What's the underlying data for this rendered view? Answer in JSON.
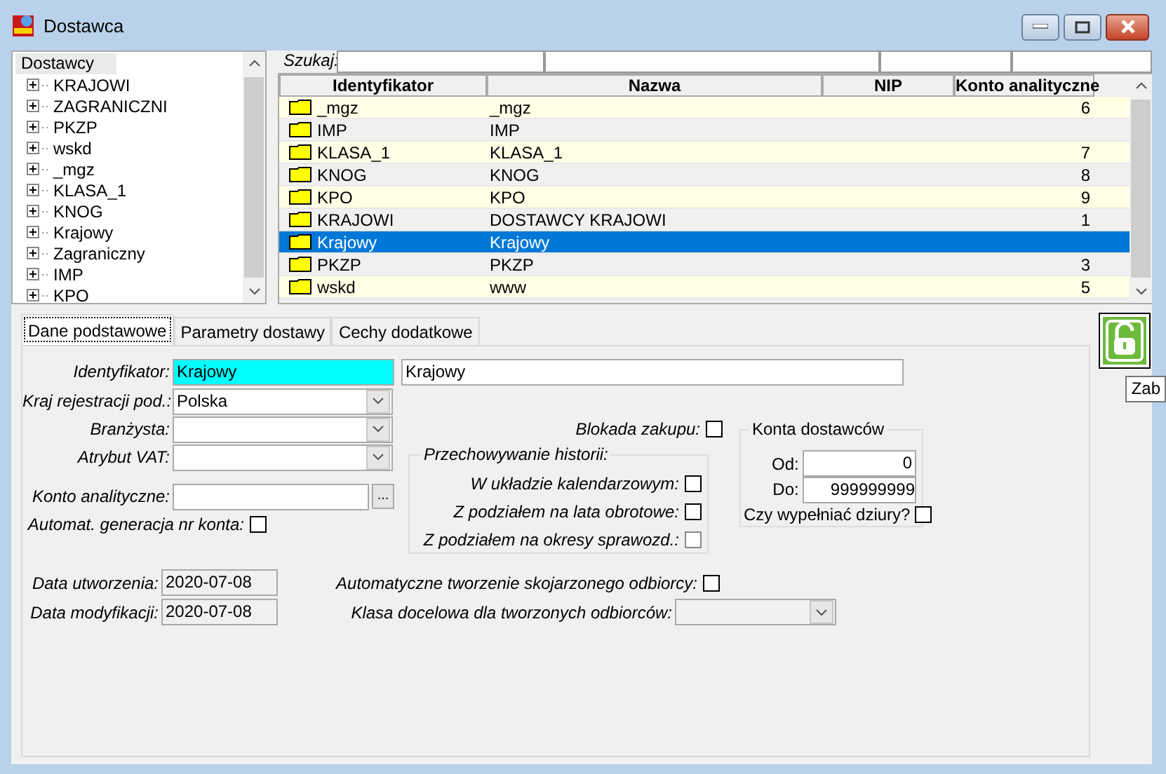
{
  "window": {
    "title": "Dostawca"
  },
  "tree": {
    "root": "Dostawcy",
    "items": [
      {
        "label": "KRAJOWI",
        "expanded": false
      },
      {
        "label": "ZAGRANICZNI",
        "expanded": false
      },
      {
        "label": "PKZP",
        "expanded": false
      },
      {
        "label": "wskd",
        "expanded": false
      },
      {
        "label": "_mgz",
        "expanded": false
      },
      {
        "label": "KLASA_1",
        "expanded": false
      },
      {
        "label": "KNOG",
        "expanded": false
      },
      {
        "label": "Krajowy",
        "expanded": false
      },
      {
        "label": "Zagraniczny",
        "expanded": false
      },
      {
        "label": "IMP",
        "expanded": false
      },
      {
        "label": "KPO",
        "expanded": false
      }
    ]
  },
  "search": {
    "label": "Szukaj:"
  },
  "table": {
    "columns": [
      "Identyfikator",
      "Nazwa",
      "NIP",
      "Konto analityczne"
    ],
    "rows": [
      {
        "identyfikator": "_mgz",
        "nazwa": "_mgz",
        "konto": "6",
        "selected": false
      },
      {
        "identyfikator": "IMP",
        "nazwa": "IMP",
        "selected": false
      },
      {
        "identyfikator": "KLASA_1",
        "nazwa": "KLASA_1",
        "konto": "7",
        "selected": false
      },
      {
        "identyfikator": "KNOG",
        "nazwa": "KNOG",
        "konto": "8",
        "selected": false
      },
      {
        "identyfikator": "KPO",
        "nazwa": "KPO",
        "konto": "9",
        "selected": false
      },
      {
        "identyfikator": "KRAJOWI",
        "nazwa": "DOSTAWCY KRAJOWI",
        "konto": "1",
        "selected": false
      },
      {
        "identyfikator": "Krajowy",
        "nazwa": "Krajowy",
        "selected": true
      },
      {
        "identyfikator": "PKZP",
        "nazwa": "PKZP",
        "konto": "3",
        "selected": false
      },
      {
        "identyfikator": "wskd",
        "nazwa": "www",
        "konto": "5",
        "selected": false
      }
    ]
  },
  "tabs": [
    {
      "label": "Dane podstawowe",
      "selected": true
    },
    {
      "label": "Parametry dostawy",
      "selected": false
    },
    {
      "label": "Cechy dodatkowe",
      "selected": false
    }
  ],
  "form": {
    "identyfikator": {
      "label": "Identyfikator:",
      "value": "Krajowy",
      "name": "Krajowy"
    },
    "combos": [
      {
        "label": "Kraj rejestracji pod.:",
        "value": "Polska"
      },
      {
        "label": "Branżysta:"
      },
      {
        "label": "Atrybut VAT:"
      }
    ],
    "konto": {
      "label": "Konto analityczne:",
      "button": "..."
    },
    "automat": {
      "label": "Automat. generacja nr konta:",
      "checked": false
    },
    "dates": [
      {
        "label": "Data utworzenia:",
        "value": "2020-07-08"
      },
      {
        "label": "Data modyfikacji:",
        "value": "2020-07-08"
      }
    ],
    "blokada": {
      "label": "Blokada zakupu:",
      "checked": false
    },
    "historia": {
      "title": "Przechowywanie historii:",
      "options": [
        {
          "label": "W układzie kalendarzowym:",
          "checked": false
        },
        {
          "label": "Z podziałem na lata obrotowe:",
          "checked": false
        },
        {
          "label": "Z podziałem na okresy sprawozd.:",
          "checked": false
        }
      ]
    },
    "konta_dostawcow": {
      "title": "Konta dostawców",
      "od": {
        "label": "Od:",
        "value": "0"
      },
      "do": {
        "label": "Do:",
        "value": "999999999"
      },
      "dziury": {
        "label": "Czy wypełniać dziury?",
        "checked": false
      }
    },
    "auto_odbiorca": {
      "label": "Automatyczne tworzenie skojarzonego odbiorcy:",
      "checked": false
    },
    "klasa": {
      "label": "Klasa docelowa dla tworzonych odbiorców:"
    }
  },
  "lock": {
    "locked": false
  },
  "tooltip": {
    "text": "Zab"
  }
}
